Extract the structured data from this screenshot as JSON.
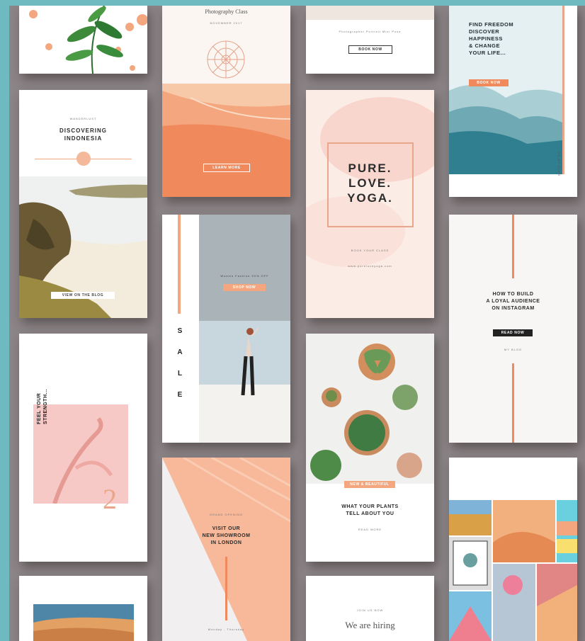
{
  "c1": {
    "circles": 6
  },
  "c2": {
    "title": "Photography Class",
    "date": "NOVEMBER 2017",
    "cta": "LEARN MORE"
  },
  "c3": {
    "caption": "Photographer Portrait Mini Pose",
    "cta": "BOOK NOW"
  },
  "c4": {
    "headline": [
      "FIND FREEDOM",
      "DISCOVER",
      "HAPPINESS",
      "& CHANGE",
      "YOUR LIFE..."
    ],
    "cta": "BOOK NOW",
    "side": "ON MY BLOG"
  },
  "c5": {
    "kicker": "WANDERLUST",
    "title": [
      "DISCOVERING",
      "INDONESIA"
    ],
    "cta": "VIEW ON THE BLOG"
  },
  "c6": {
    "lines": [
      "PURE.",
      "LOVE.",
      "YOGA."
    ],
    "sub": "BOOK YOUR CLASS",
    "url": "www.pureloveyoga.com"
  },
  "c7": {
    "letters": [
      "S",
      "A",
      "L",
      "E"
    ],
    "caption": "Women Fashion  50% OFF",
    "cta": "SHOP NOW"
  },
  "c8": {
    "title": [
      "HOW TO BUILD",
      "A LOYAL AUDIENCE",
      "ON INSTAGRAM"
    ],
    "cta": "READ NOW",
    "sub": "MY BLOG"
  },
  "c9": {
    "vertical": [
      "FEEL YOUR",
      "STRENGTH..."
    ],
    "number": "2"
  },
  "c10": {
    "badge": "NEW & BEAUTIFUL",
    "title": [
      "WHAT YOUR PLANTS",
      "TELL ABOUT YOU"
    ],
    "sub": "READ MORE"
  },
  "c11": {
    "kicker": "GRAND OPENING",
    "title": [
      "VISIT OUR",
      "NEW SHOWROOM",
      "IN LONDON"
    ],
    "footer": "Monday - Thursday"
  },
  "c12": {
    "kicker": "JOIN US NOW",
    "title": "We are hiring"
  },
  "colors": {
    "teal": "#6fb9c0",
    "peach": "#f4a77e",
    "coral": "#f08a5d",
    "rose": "#e9a6a0",
    "dark": "#222222"
  }
}
